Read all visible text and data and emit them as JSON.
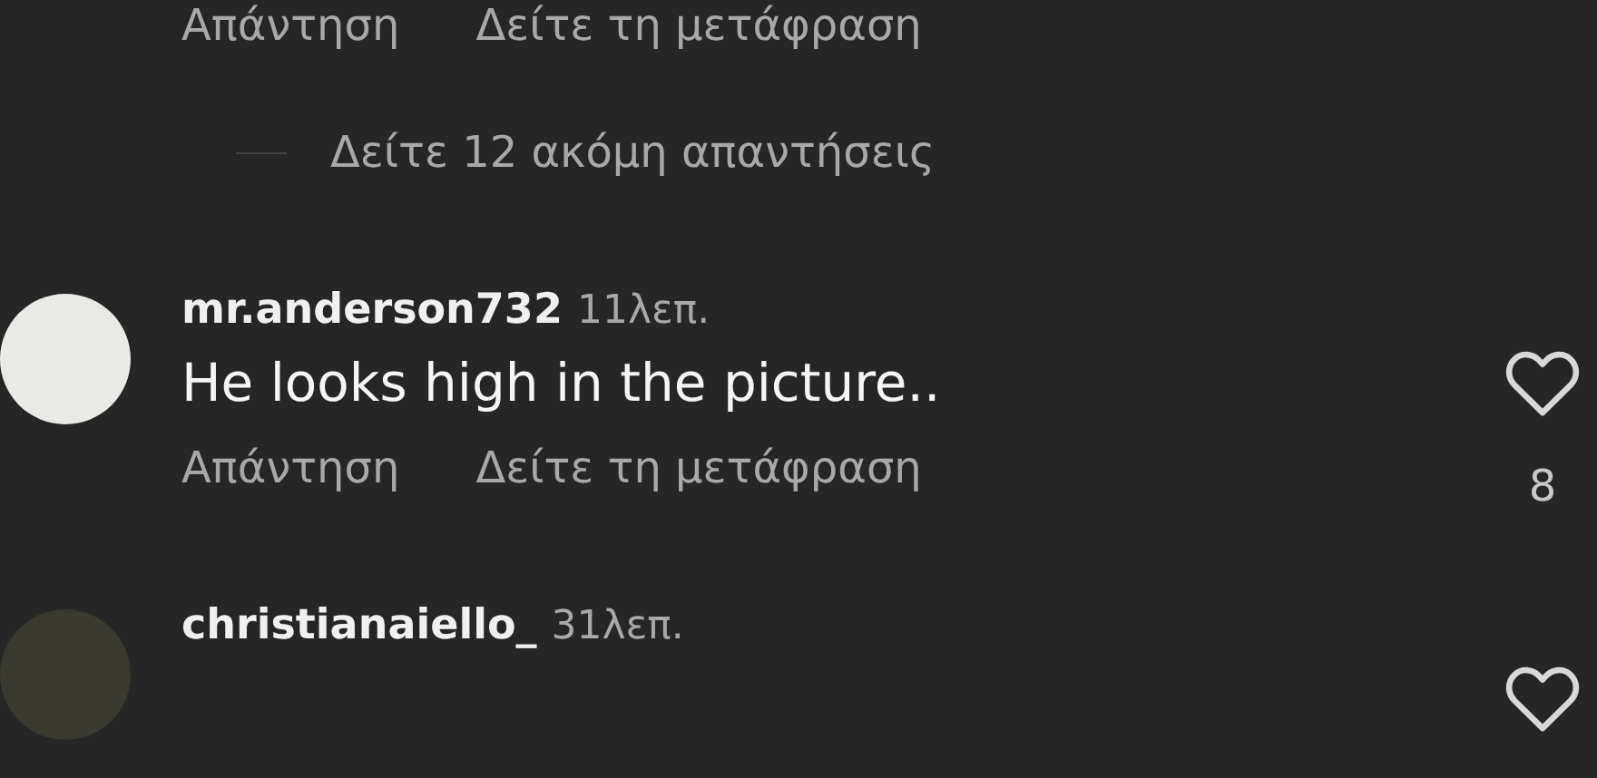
{
  "top_actions": {
    "reply": "Απάντηση",
    "translate": "Δείτε τη μετάφραση"
  },
  "more_replies": "Δείτε 12 ακόμη απαντήσεις",
  "comments": [
    {
      "username": "mr.anderson732",
      "time": "11λεπ.",
      "text": "He looks high in the picture..",
      "reply": "Απάντηση",
      "translate": "Δείτε τη μετάφραση",
      "likes": "8"
    },
    {
      "username": "christianaiello_",
      "time": "31λεπ."
    }
  ]
}
